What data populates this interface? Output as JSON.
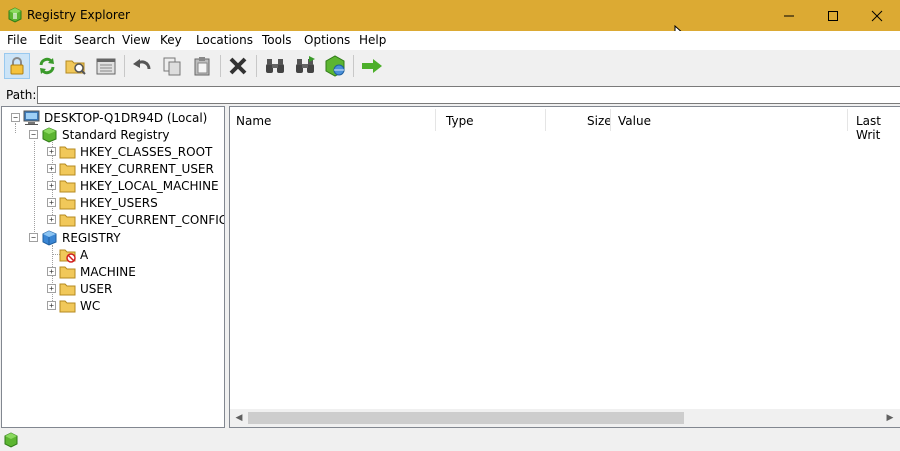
{
  "window": {
    "title": "Registry Explorer"
  },
  "menu": [
    "File",
    "Edit",
    "Search",
    "View",
    "Key",
    "Locations",
    "Tools",
    "Options",
    "Help"
  ],
  "toolbar": {
    "buttons": [
      "lock-icon",
      "refresh-icon",
      "open-folder-icon",
      "hive-icon",
      "undo-icon",
      "copy-icon",
      "paste-icon",
      "delete-icon",
      "find-icon",
      "find-next-icon",
      "registry-globe-icon",
      "go-arrow-icon"
    ]
  },
  "path": {
    "label": "Path:",
    "value": ""
  },
  "tree": {
    "computer": "DESKTOP-Q1DR94D (Local)",
    "standard_registry": "Standard Registry",
    "hives": [
      "HKEY_CLASSES_ROOT",
      "HKEY_CURRENT_USER",
      "HKEY_LOCAL_MACHINE",
      "HKEY_USERS",
      "HKEY_CURRENT_CONFIG"
    ],
    "registry": "REGISTRY",
    "registry_children": [
      "A",
      "MACHINE",
      "USER",
      "WC"
    ]
  },
  "list": {
    "columns": [
      "Name",
      "Type",
      "Size",
      "Value",
      "Last Writ"
    ]
  },
  "colors": {
    "titlebar": "#dcaa33",
    "folder": "#f1c85a",
    "accent_green": "#5cb531"
  }
}
